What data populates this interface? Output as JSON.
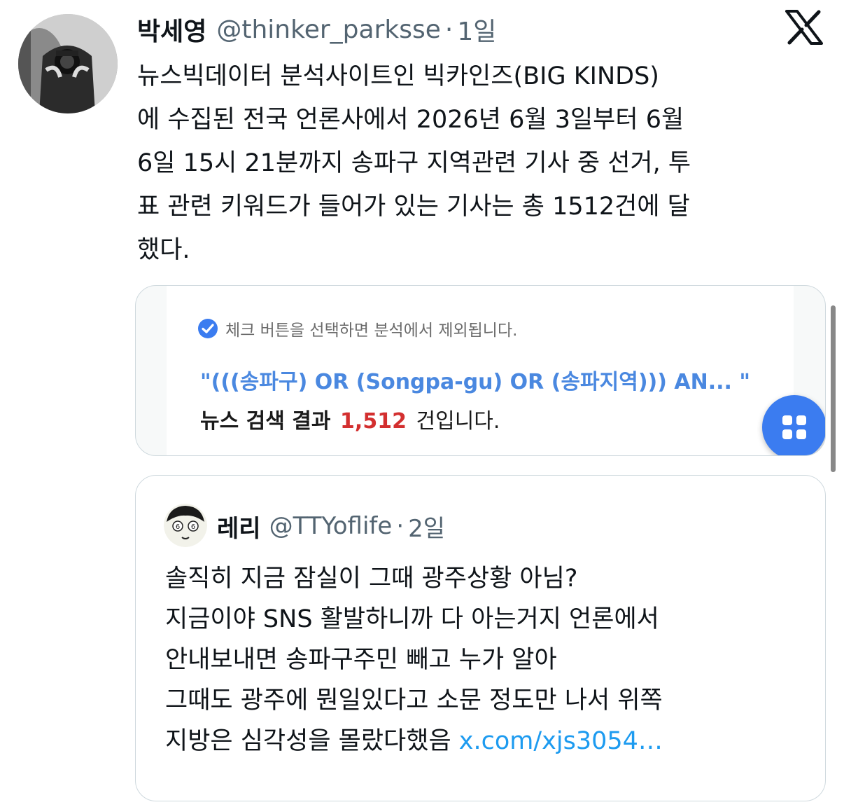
{
  "tweet": {
    "author_name": "박세영",
    "author_handle": "@thinker_parksse",
    "separator": "·",
    "time": "1일",
    "text_lines": [
      "뉴스빅데이터 분석사이트인 빅카인즈(BIG KINDS)",
      "에 수집된 전국 언론사에서 2026년 6월 3일부터 6월",
      "6일 15시 21분까지 송파구 지역관련 기사 중 선거, 투",
      "표 관련 키워드가 들어가 있는 기사는 총 1512건에 달",
      "했다."
    ]
  },
  "media": {
    "check_text": "체크 버튼을 선택하면 분석에서 제외됩니다.",
    "query_text": "\"(((송파구) OR (Songpa-gu) OR (송파지역))) AN...  \"",
    "result_label": "뉴스 검색 결과",
    "result_count": "1,512",
    "result_suffix": "건입니다."
  },
  "quote": {
    "author_name": "레리",
    "author_handle": "@TTYoflife",
    "separator": "·",
    "time": "2일",
    "text_lines": [
      "솔직히 지금 잠실이 그때 광주상황 아님?",
      "지금이야 SNS 활발하니까 다 아는거지 언론에서",
      "안내보내면 송파구주민 빼고 누가 알아",
      "그때도 광주에 뭔일있다고 소문 정도만 나서 위쪽"
    ],
    "last_line_text": "지방은 심각성을 몰랐다했음 ",
    "link_text": "x.com/xjs3054…"
  },
  "icons": {
    "brand": "x-logo-icon",
    "check": "check-circle-icon",
    "fab": "grid-icon"
  },
  "colors": {
    "link": "#1d9bf0",
    "secondary_text": "#536471",
    "query": "#4a88e0",
    "count": "#d32f2f",
    "fab": "#3b7cf0"
  }
}
